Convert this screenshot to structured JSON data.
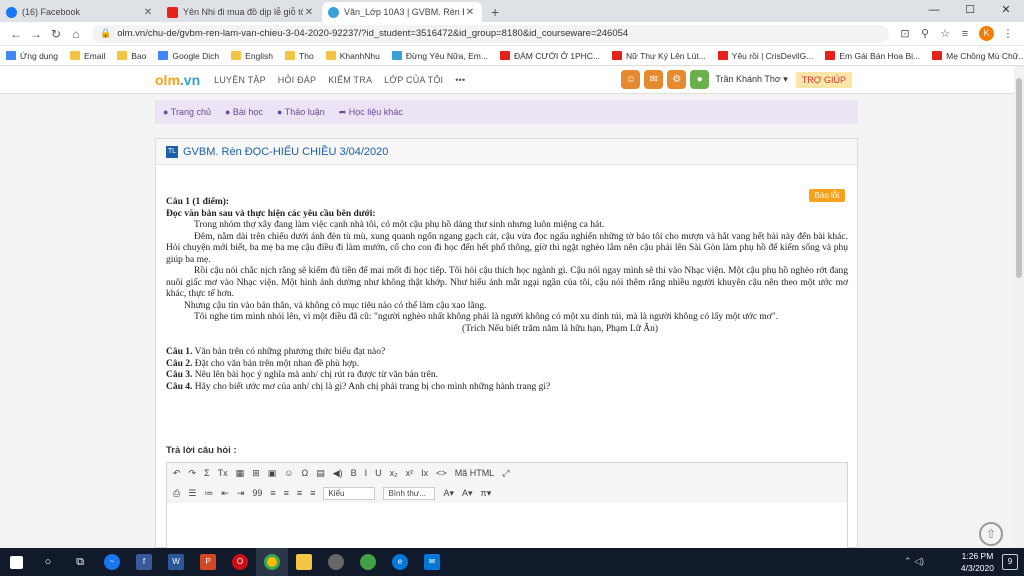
{
  "browser": {
    "tabs": [
      {
        "title": "(16) Facebook",
        "color": "#1877f2"
      },
      {
        "title": "Yên Nhi đi mua đồ dịp lễ giỗ tổ",
        "color": "#e62117"
      },
      {
        "title": "Văn_Lớp 10A3 | GVBM. Rèn ĐỌC...",
        "color": "#3aa0d8"
      }
    ],
    "new_tab": "+",
    "url": "olm.vn/chu-de/gvbm-ren-lam-van-chieu-3-04-2020-92237/?id_student=3516472&id_group=8180&id_courseware=246054",
    "profile_initial": "K"
  },
  "bookmarks": [
    {
      "label": "Ứng dụng",
      "color": "#4285f4"
    },
    {
      "label": "Email",
      "color": "#f4c542"
    },
    {
      "label": "Bao",
      "color": "#f4c542"
    },
    {
      "label": "Google Dịch",
      "color": "#4285f4"
    },
    {
      "label": "English",
      "color": "#f4c542"
    },
    {
      "label": "Tho",
      "color": "#f4c542"
    },
    {
      "label": "KhanhNhu",
      "color": "#f4c542"
    },
    {
      "label": "Đừng Yêu Nữa, Em...",
      "color": "#3aa0d8"
    },
    {
      "label": "ĐÁM CƯỚI Ở 1PHC...",
      "color": "#e62117"
    },
    {
      "label": "Nữ Thư Ký Lên Lút...",
      "color": "#e62117"
    },
    {
      "label": "Yêu rồi | CrisDevilG...",
      "color": "#e62117"
    },
    {
      "label": "Em Gái Bán Hoa Bị...",
      "color": "#e62117"
    },
    {
      "label": "Mẹ Chồng Mù Chữ...",
      "color": "#e62117"
    }
  ],
  "site": {
    "logo_main": "olm",
    "logo_suffix": ".vn",
    "menu": [
      "LUYỆN TẬP",
      "HỎI ĐÁP",
      "KIỂM TRA",
      "LỚP CỦA TÔI",
      "•••"
    ],
    "user": "Trần Khánh Thơ ▾",
    "help": "TRỢ GIÚP",
    "subnav": [
      "● Trang chủ",
      "● Bài học",
      "● Thảo luận",
      "➦ Học liệu khác"
    ]
  },
  "card": {
    "badge": "TL",
    "title": "GVBM. Rèn ĐỌC-HIỂU CHIỀU 3/04/2020",
    "report": "Báo lỗi",
    "q_header": "Câu 1 (1 điểm):",
    "instruction": "Đọc văn bản sau và thực hiện các yêu cầu bên dưới:",
    "passage": [
      "Trong nhóm thợ xây đang làm việc cạnh nhà tôi, có một cậu phụ hồ dáng thư sinh nhưng luôn miệng ca hát.",
      "Đêm, nằm dài trên chiếu dưới ánh đèn tù mù, xung quanh ngổn ngang gạch cát, cậu vừa đọc ngấu nghiến những tờ báo tôi cho mượn và hắt vang hết bài này đến bài khác. Hỏi chuyện mới biết, ba mẹ ba mẹ cậu điều đi làm mướn, cố cho con đi học đến hết phổ thông, giờ thì ngặt nghèo lắm nên cậu phải lên Sài Gòn làm phụ hồ để kiếm sống và phụ giúp ba mẹ.",
      "Rồi cậu nói chắc nịch rằng sẽ kiếm đủ tiền để mai mốt đi học tiếp. Tôi hỏi cậu thích học ngành gì. Cậu nói ngay mình sẽ thi vào Nhạc viện. Một cậu phụ hồ nghèo rớt đang nuôi giấc mơ vào Nhạc viện. Một hình ảnh dường như không thật khớp. Như hiểu ánh mắt ngại ngần của tôi, cậu nói thêm rằng nhiều người khuyên cậu nên theo một ước mơ khác, thực tế hơn.",
      "Nhưng cậu tin vào bản thân, và không có mục tiêu nào có thể làm cậu xao lãng.",
      "Tôi nghe tim mình nhói lên, vì một điều đã cũ: \"người nghèo nhất không phải là người không có một xu dính túi, mà là người không có lấy một ước mơ\"."
    ],
    "citation": "(Trích Nếu biết trăm năm là hữu hạn, Phạm Lữ Ân)",
    "questions": [
      {
        "label": "Câu 1.",
        "text": " Văn bản trên có những phương thức biểu đạt nào?"
      },
      {
        "label": "Câu 2.",
        "text": " Đặt cho văn bản trên một nhan đề phù hợp."
      },
      {
        "label": "Câu 3.",
        "text": " Nêu lên bài học ý nghĩa mà anh/ chị rút ra được từ văn bản trên."
      },
      {
        "label": "Câu 4.",
        "text": " Hãy cho biết ước mơ của anh/ chị là gì? Anh chị phải trang bị cho mình những hành trang gì?"
      }
    ],
    "answer_label": "Trả lời câu hỏi :",
    "toolbar1": [
      "↶",
      "↷",
      "Σ",
      "Tx",
      "▦",
      "⊞",
      "▣",
      "☺",
      "Ω",
      "▤",
      "◀)",
      "B",
      "I",
      "U",
      "x₂",
      "x²",
      "Ix",
      "<>",
      "Mã HTML",
      "⤢"
    ],
    "toolbar2": [
      "⎙",
      "☰",
      "≔",
      "⇤",
      "⇥",
      "99",
      "≡",
      "≡",
      "≡",
      "≡"
    ],
    "style_select": "Kiểu",
    "format_select": "Bình thư...",
    "toolbar3": [
      "A▾",
      "A▾",
      "π▾"
    ]
  },
  "taskbar": {
    "time": "1:26 PM",
    "date": "4/3/2020",
    "notifications": "9"
  }
}
